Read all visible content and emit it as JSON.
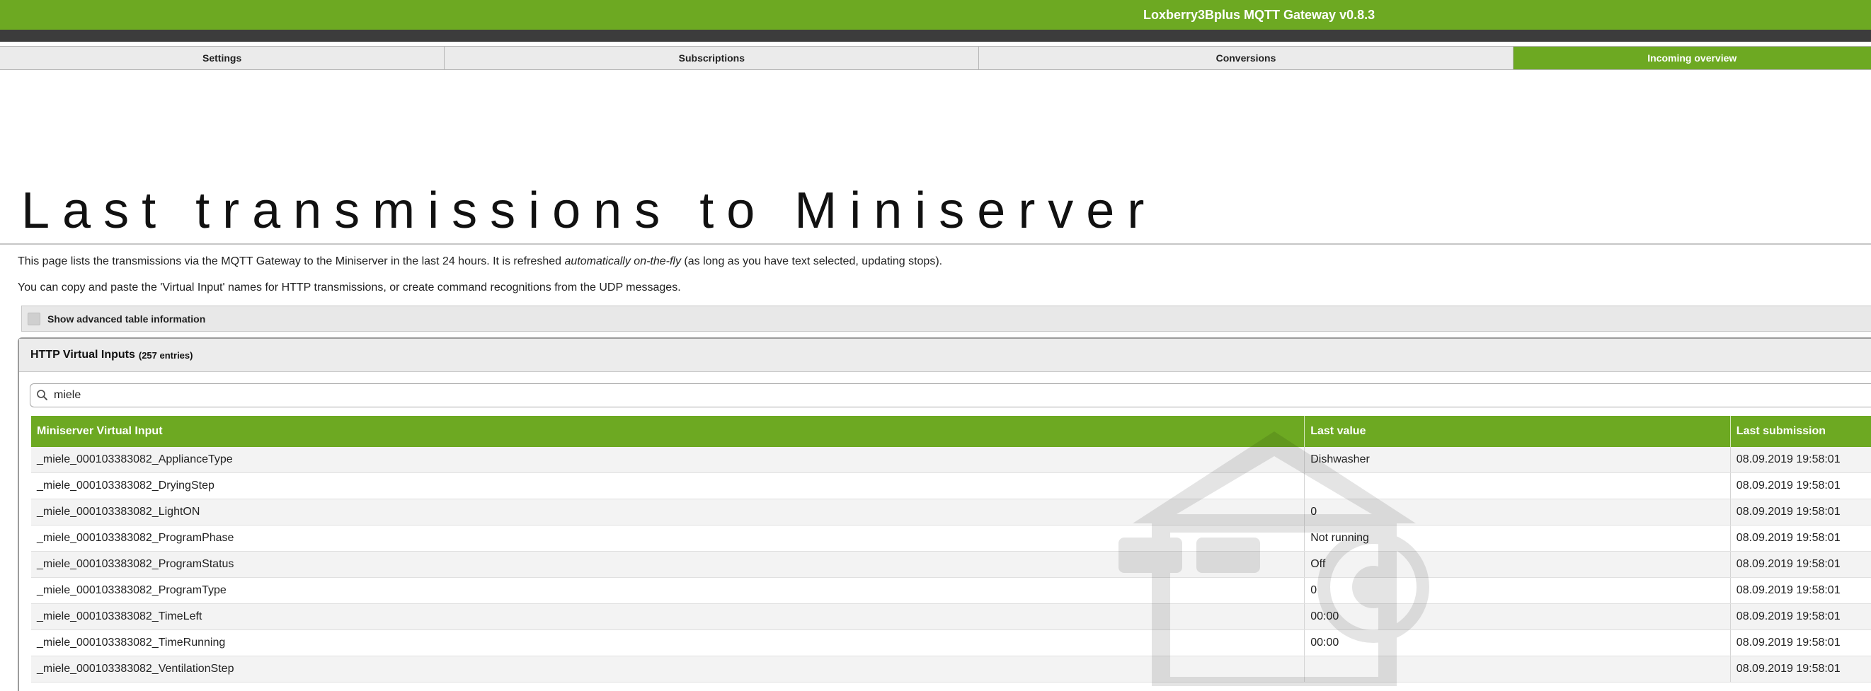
{
  "header": {
    "title": "Loxberry3Bplus MQTT Gateway v0.8.3"
  },
  "tabs": [
    {
      "label": "Settings",
      "active": false
    },
    {
      "label": "Subscriptions",
      "active": false
    },
    {
      "label": "Conversions",
      "active": false
    },
    {
      "label": "Incoming overview",
      "active": true
    }
  ],
  "page": {
    "title": "Last transmissions to Miniserver",
    "desc1_a": "This page lists the transmissions via the MQTT Gateway to the Miniserver in the last 24 hours. It is refreshed ",
    "desc1_em": "automatically on-the-fly",
    "desc1_b": " (as long as you have text selected, updating stops).",
    "desc2": "You can copy and paste the 'Virtual Input' names for HTTP transmissions, or create command recognitions from the UDP messages."
  },
  "advanced": {
    "label": "Show advanced table information",
    "checked": false
  },
  "panel": {
    "title": "HTTP Virtual Inputs",
    "count": "(257 entries)",
    "search_value": "miele"
  },
  "table": {
    "headers": [
      "Miniserver Virtual Input",
      "Last value",
      "Last submission"
    ],
    "rows": [
      [
        "_miele_000103383082_ApplianceType",
        "Dishwasher",
        "08.09.2019 19:58:01"
      ],
      [
        "_miele_000103383082_DryingStep",
        "",
        "08.09.2019 19:58:01"
      ],
      [
        "_miele_000103383082_LightON",
        "0",
        "08.09.2019 19:58:01"
      ],
      [
        "_miele_000103383082_ProgramPhase",
        "Not running",
        "08.09.2019 19:58:01"
      ],
      [
        "_miele_000103383082_ProgramStatus",
        "Off",
        "08.09.2019 19:58:01"
      ],
      [
        "_miele_000103383082_ProgramType",
        "0",
        "08.09.2019 19:58:01"
      ],
      [
        "_miele_000103383082_TimeLeft",
        "00:00",
        "08.09.2019 19:58:01"
      ],
      [
        "_miele_000103383082_TimeRunning",
        "00:00",
        "08.09.2019 19:58:01"
      ],
      [
        "_miele_000103383082_VentilationStep",
        "",
        "08.09.2019 19:58:01"
      ]
    ]
  },
  "colors": {
    "accent": "#6da922",
    "dark_bar": "#3c3c3c",
    "row_alt": "#f3f3f3"
  }
}
